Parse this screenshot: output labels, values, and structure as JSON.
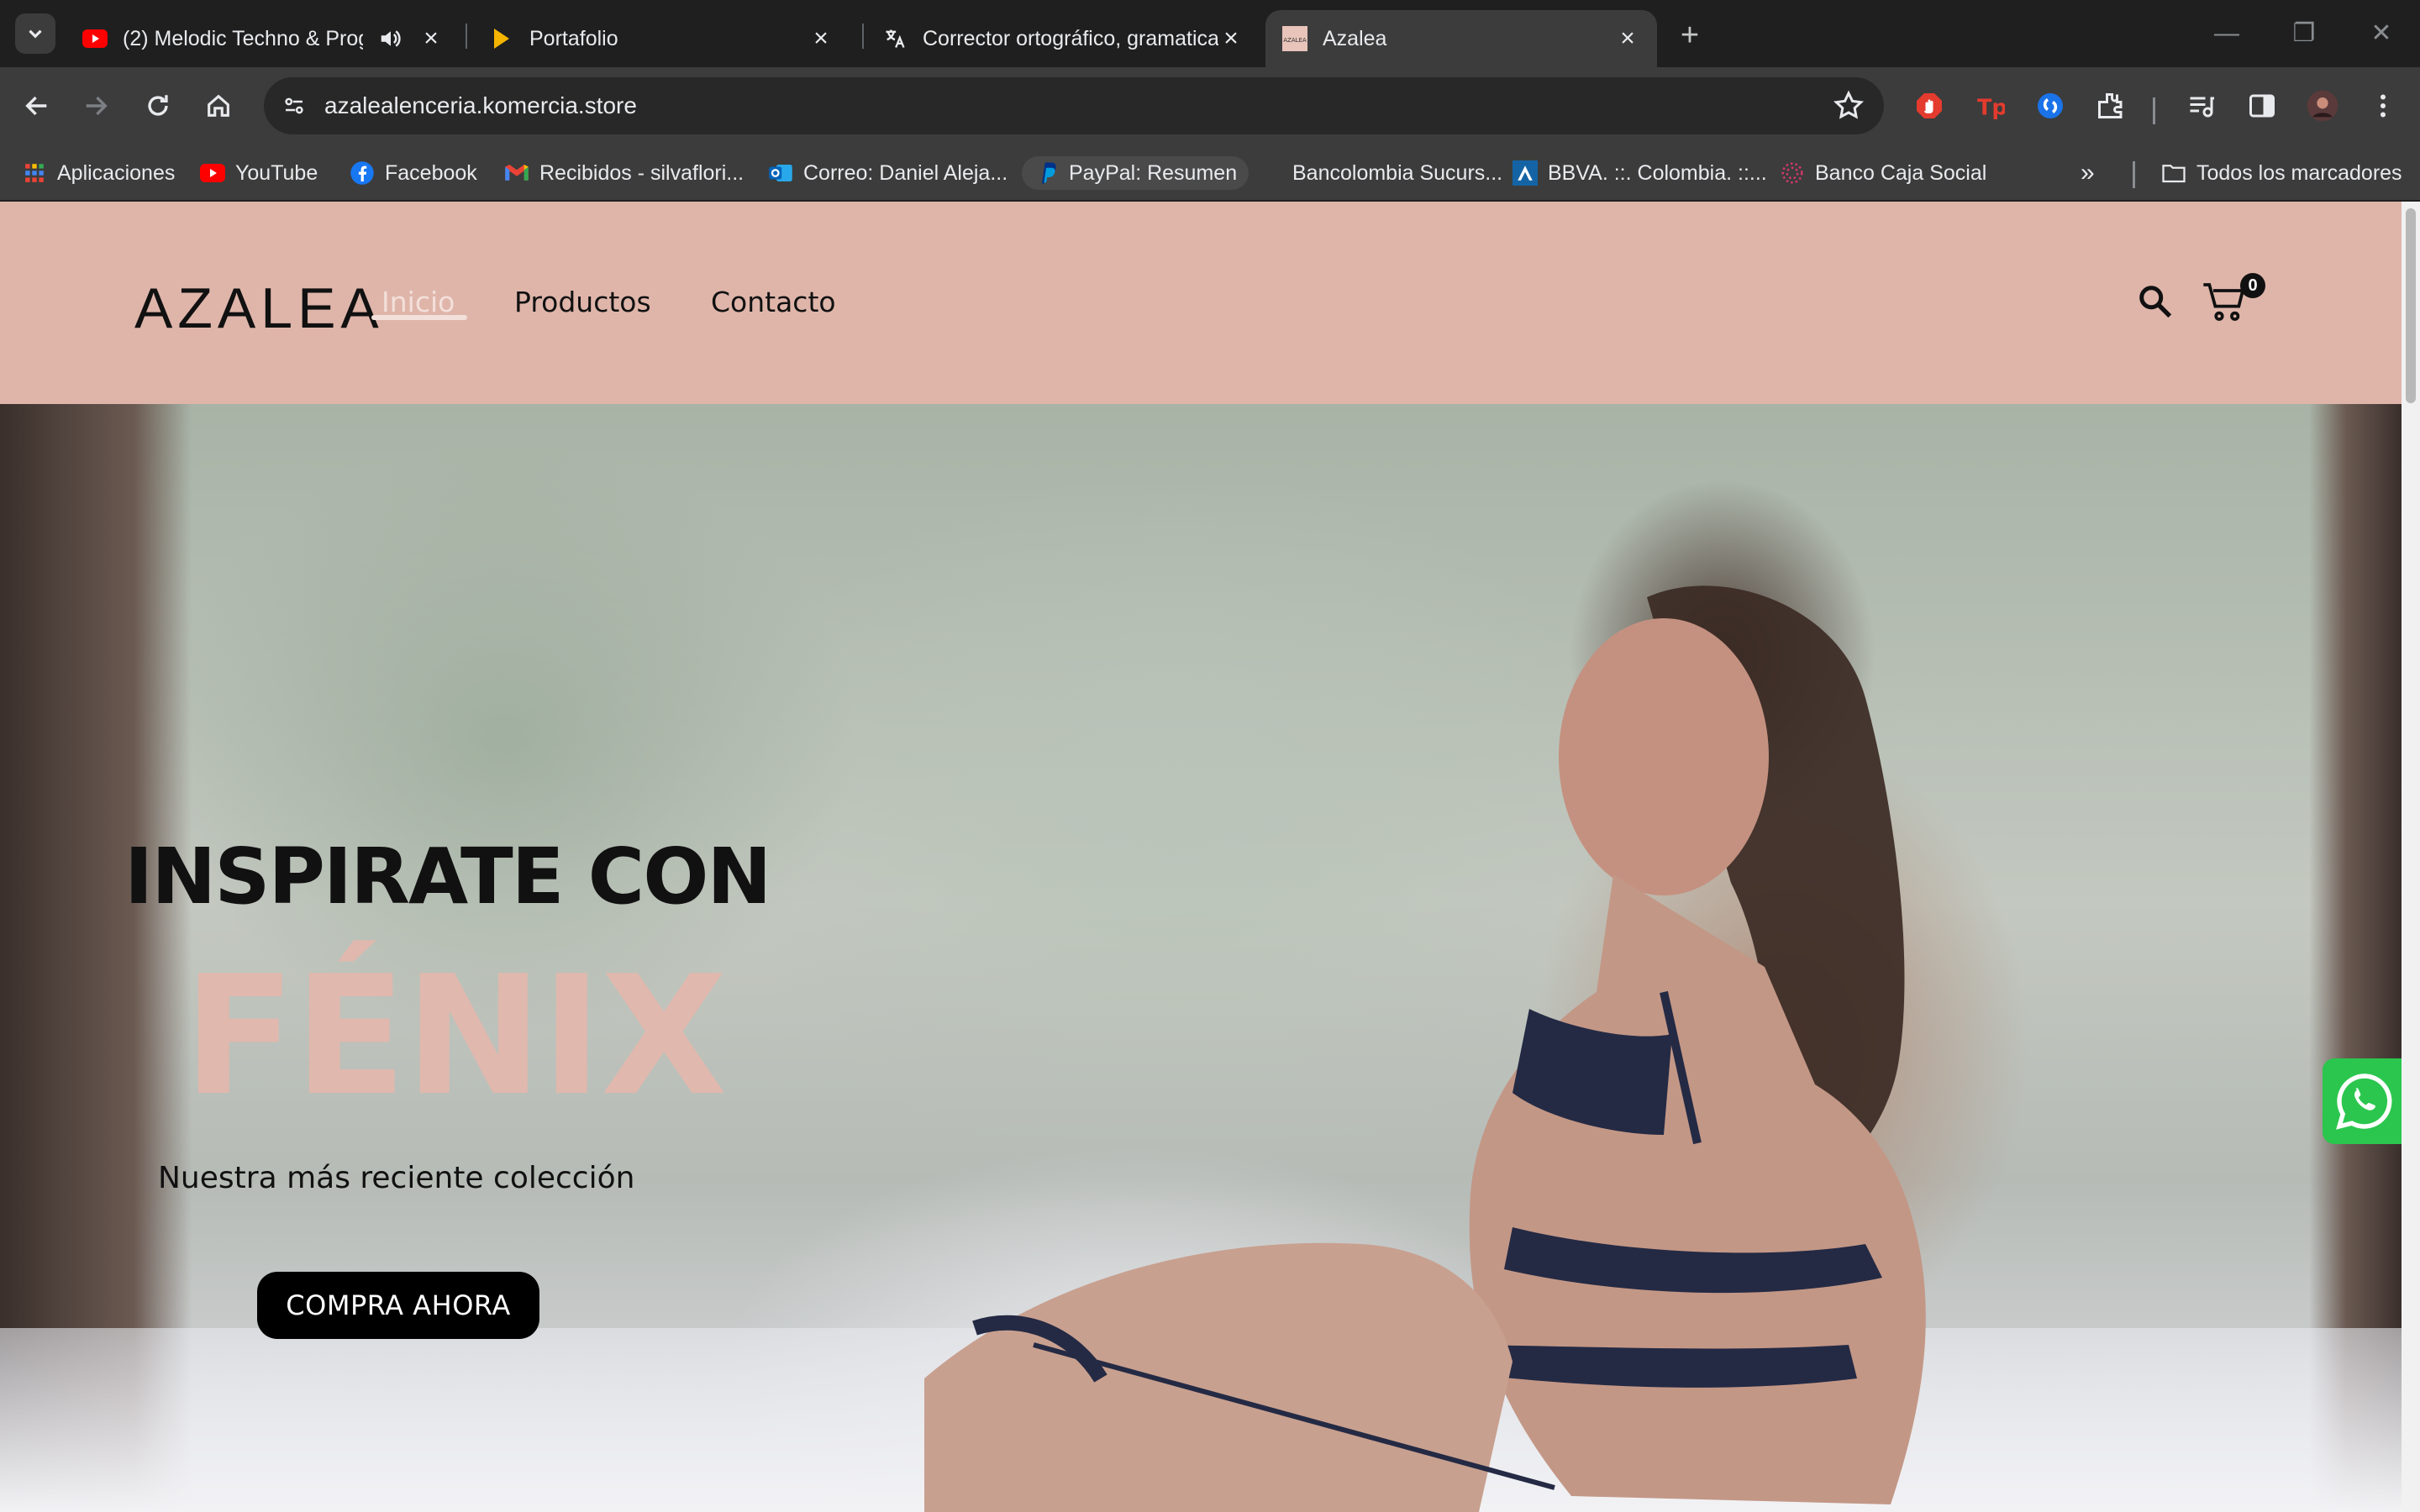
{
  "browser": {
    "tabs": [
      {
        "title": "(2) Melodic Techno & Progr",
        "favicon": "youtube-icon",
        "audio": true
      },
      {
        "title": "Portafolio",
        "favicon": "portfolio-icon"
      },
      {
        "title": "Corrector ortográfico, gramatica",
        "favicon": "translate-icon"
      },
      {
        "title": "Azalea",
        "favicon": "azalea-icon",
        "active": true
      }
    ],
    "url": "azalealenceria.komercia.store",
    "bookmarks": [
      {
        "label": "Aplicaciones",
        "icon": "apps-grid-icon"
      },
      {
        "label": "YouTube",
        "icon": "youtube-icon"
      },
      {
        "label": "Facebook",
        "icon": "facebook-icon"
      },
      {
        "label": "Recibidos - silvaflori...",
        "icon": "gmail-icon"
      },
      {
        "label": "Correo: Daniel Aleja...",
        "icon": "outlook-icon"
      },
      {
        "label": "PayPal: Resumen",
        "icon": "paypal-icon"
      },
      {
        "label": "Bancolombia Sucurs...",
        "icon": "bancolombia-icon"
      },
      {
        "label": "BBVA. ::. Colombia. ::...",
        "icon": "bbva-icon"
      },
      {
        "label": "Banco Caja Social",
        "icon": "caja-social-icon"
      }
    ],
    "all_bookmarks_label": "Todos los marcadores"
  },
  "site": {
    "logo": "AZALEA",
    "nav": {
      "home": "Inicio",
      "products": "Productos",
      "contact": "Contacto"
    },
    "cart_count": "0"
  },
  "hero": {
    "title": "INSPIRATE CON",
    "accent": "FÉNIX",
    "subtitle": "Nuestra más reciente colección",
    "cta": "COMPRA AHORA"
  },
  "colors": {
    "header_bg": "#dfb5aa",
    "accent": "#e0b8ad",
    "whatsapp": "#2bc64e"
  }
}
